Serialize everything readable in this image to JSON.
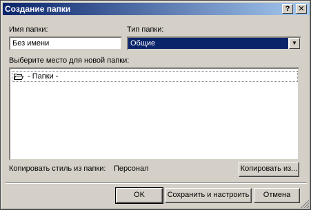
{
  "window": {
    "title": "Создание папки",
    "help_label": "?",
    "close_label": "✕"
  },
  "folder_name": {
    "label": "Имя папки:",
    "value": "Без имени"
  },
  "folder_type": {
    "label": "Тип папки:",
    "selected": "Общие"
  },
  "location": {
    "label": "Выберите место для новой папки:",
    "items": [
      {
        "label": "- Папки -",
        "icon": "folder-open-icon"
      }
    ]
  },
  "copy_style": {
    "label": "Копировать стиль из папки:",
    "value": "Персонал",
    "button": "Копировать из..."
  },
  "buttons": {
    "ok": "OK",
    "save_configure": "Сохранить и настроить",
    "cancel": "Отмена"
  },
  "colors": {
    "titlebar_start": "#0a246a",
    "titlebar_end": "#a6caf0",
    "face": "#d4d0c8",
    "selection": "#0a246a"
  }
}
